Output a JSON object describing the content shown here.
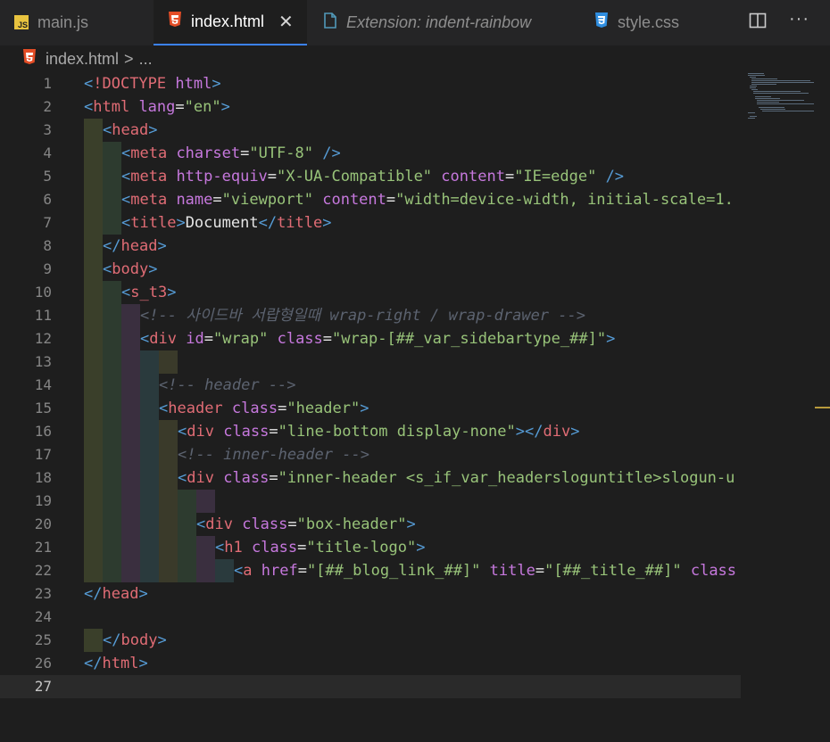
{
  "tabs": [
    {
      "label": "main.js",
      "icon": "js-file-icon"
    },
    {
      "label": "index.html",
      "icon": "html5-file-icon",
      "active": true
    },
    {
      "label": "Extension: indent-rainbow",
      "icon": "extension-file-icon"
    },
    {
      "label": "style.css",
      "icon": "css3-file-icon"
    }
  ],
  "breadcrumb": {
    "file": "index.html",
    "sep": ">",
    "rest": "..."
  },
  "current_line": 27,
  "colors": {
    "accent": "#3b82f6",
    "tag": "#e06c75",
    "attr": "#c678dd",
    "string": "#98c379",
    "comment": "#5c6370"
  },
  "lines": [
    {
      "n": "1",
      "indent": 0,
      "segs": [
        [
          "t",
          "<"
        ],
        [
          "tg",
          "!DOCTYPE"
        ],
        [
          "at",
          " html"
        ],
        [
          "t",
          ">"
        ]
      ]
    },
    {
      "n": "2",
      "indent": 0,
      "segs": [
        [
          "t",
          "<"
        ],
        [
          "tg",
          "html"
        ],
        [
          "at",
          " lang"
        ],
        [
          "tx",
          "="
        ],
        [
          "st",
          "\"en\""
        ],
        [
          "t",
          ">"
        ]
      ]
    },
    {
      "n": "3",
      "indent": 1,
      "segs": [
        [
          "t",
          "<"
        ],
        [
          "tg",
          "head"
        ],
        [
          "t",
          ">"
        ]
      ]
    },
    {
      "n": "4",
      "indent": 2,
      "segs": [
        [
          "t",
          "<"
        ],
        [
          "tg",
          "meta"
        ],
        [
          "at",
          " charset"
        ],
        [
          "tx",
          "="
        ],
        [
          "st",
          "\"UTF-8\""
        ],
        [
          "tx",
          " "
        ],
        [
          "t",
          "/>"
        ]
      ]
    },
    {
      "n": "5",
      "indent": 2,
      "segs": [
        [
          "t",
          "<"
        ],
        [
          "tg",
          "meta"
        ],
        [
          "at",
          " http-equiv"
        ],
        [
          "tx",
          "="
        ],
        [
          "st",
          "\"X-UA-Compatible\""
        ],
        [
          "at",
          " content"
        ],
        [
          "tx",
          "="
        ],
        [
          "st",
          "\"IE=edge\""
        ],
        [
          "tx",
          " "
        ],
        [
          "t",
          "/>"
        ]
      ]
    },
    {
      "n": "6",
      "indent": 2,
      "segs": [
        [
          "t",
          "<"
        ],
        [
          "tg",
          "meta"
        ],
        [
          "at",
          " name"
        ],
        [
          "tx",
          "="
        ],
        [
          "st",
          "\"viewport\""
        ],
        [
          "at",
          " content"
        ],
        [
          "tx",
          "="
        ],
        [
          "st",
          "\"width=device-width, initial-scale=1."
        ]
      ]
    },
    {
      "n": "7",
      "indent": 2,
      "segs": [
        [
          "t",
          "<"
        ],
        [
          "tg",
          "title"
        ],
        [
          "t",
          ">"
        ],
        [
          "tx",
          "Document"
        ],
        [
          "t",
          "</"
        ],
        [
          "tg",
          "title"
        ],
        [
          "t",
          ">"
        ]
      ]
    },
    {
      "n": "8",
      "indent": 1,
      "segs": [
        [
          "t",
          "</"
        ],
        [
          "tg",
          "head"
        ],
        [
          "t",
          ">"
        ]
      ]
    },
    {
      "n": "9",
      "indent": 1,
      "segs": [
        [
          "t",
          "<"
        ],
        [
          "tg",
          "body"
        ],
        [
          "t",
          ">"
        ]
      ]
    },
    {
      "n": "10",
      "indent": 2,
      "segs": [
        [
          "t",
          "<"
        ],
        [
          "tg",
          "s_t3"
        ],
        [
          "t",
          ">"
        ]
      ]
    },
    {
      "n": "11",
      "indent": 3,
      "segs": [
        [
          "cm",
          "<!-- 사이드바 서랍형일때 wrap-right / wrap-drawer -->"
        ]
      ]
    },
    {
      "n": "12",
      "indent": 3,
      "segs": [
        [
          "t",
          "<"
        ],
        [
          "tg",
          "div"
        ],
        [
          "at",
          " id"
        ],
        [
          "tx",
          "="
        ],
        [
          "st",
          "\"wrap\""
        ],
        [
          "at",
          " class"
        ],
        [
          "tx",
          "="
        ],
        [
          "st",
          "\"wrap-[##_var_sidebartype_##]\""
        ],
        [
          "t",
          ">"
        ]
      ]
    },
    {
      "n": "13",
      "indent": 0,
      "segs": []
    },
    {
      "n": "14",
      "indent": 4,
      "segs": [
        [
          "cm",
          "<!-- header -->"
        ]
      ]
    },
    {
      "n": "15",
      "indent": 4,
      "segs": [
        [
          "t",
          "<"
        ],
        [
          "tg",
          "header"
        ],
        [
          "at",
          " class"
        ],
        [
          "tx",
          "="
        ],
        [
          "st",
          "\"header\""
        ],
        [
          "t",
          ">"
        ]
      ]
    },
    {
      "n": "16",
      "indent": 5,
      "segs": [
        [
          "t",
          "<"
        ],
        [
          "tg",
          "div"
        ],
        [
          "at",
          " class"
        ],
        [
          "tx",
          "="
        ],
        [
          "st",
          "\"line-bottom display-none\""
        ],
        [
          "t",
          "></"
        ],
        [
          "tg",
          "div"
        ],
        [
          "t",
          ">"
        ]
      ]
    },
    {
      "n": "17",
      "indent": 5,
      "segs": [
        [
          "cm",
          "<!-- inner-header -->"
        ]
      ]
    },
    {
      "n": "18",
      "indent": 5,
      "segs": [
        [
          "t",
          "<"
        ],
        [
          "tg",
          "div"
        ],
        [
          "at",
          " class"
        ],
        [
          "tx",
          "="
        ],
        [
          "st",
          "\"inner-header <s_if_var_headersloguntitle>slogun-u"
        ]
      ]
    },
    {
      "n": "19",
      "indent": 0,
      "segs": []
    },
    {
      "n": "20",
      "indent": 6,
      "segs": [
        [
          "t",
          "<"
        ],
        [
          "tg",
          "div"
        ],
        [
          "at",
          " class"
        ],
        [
          "tx",
          "="
        ],
        [
          "st",
          "\"box-header\""
        ],
        [
          "t",
          ">"
        ]
      ]
    },
    {
      "n": "21",
      "indent": 7,
      "segs": [
        [
          "t",
          "<"
        ],
        [
          "tg",
          "h1"
        ],
        [
          "at",
          " class"
        ],
        [
          "tx",
          "="
        ],
        [
          "st",
          "\"title-logo\""
        ],
        [
          "t",
          ">"
        ]
      ]
    },
    {
      "n": "22",
      "indent": 8,
      "segs": [
        [
          "t",
          "<"
        ],
        [
          "tg",
          "a"
        ],
        [
          "at",
          " href"
        ],
        [
          "tx",
          "="
        ],
        [
          "st",
          "\"[##_blog_link_##]\""
        ],
        [
          "at",
          " title"
        ],
        [
          "tx",
          "="
        ],
        [
          "st",
          "\"[##_title_##]\""
        ],
        [
          "at",
          " class"
        ]
      ]
    },
    {
      "n": "23",
      "indent": 0,
      "segs": [
        [
          "t",
          "</"
        ],
        [
          "tg",
          "head"
        ],
        [
          "t",
          ">"
        ]
      ]
    },
    {
      "n": "24",
      "indent": 0,
      "segs": []
    },
    {
      "n": "25",
      "indent": 1,
      "segs": [
        [
          "t",
          "</"
        ],
        [
          "tg",
          "body"
        ],
        [
          "t",
          ">"
        ]
      ]
    },
    {
      "n": "26",
      "indent": 0,
      "segs": [
        [
          "t",
          "</"
        ],
        [
          "tg",
          "html"
        ],
        [
          "t",
          ">"
        ]
      ]
    },
    {
      "n": "27",
      "indent": 0,
      "segs": []
    }
  ]
}
